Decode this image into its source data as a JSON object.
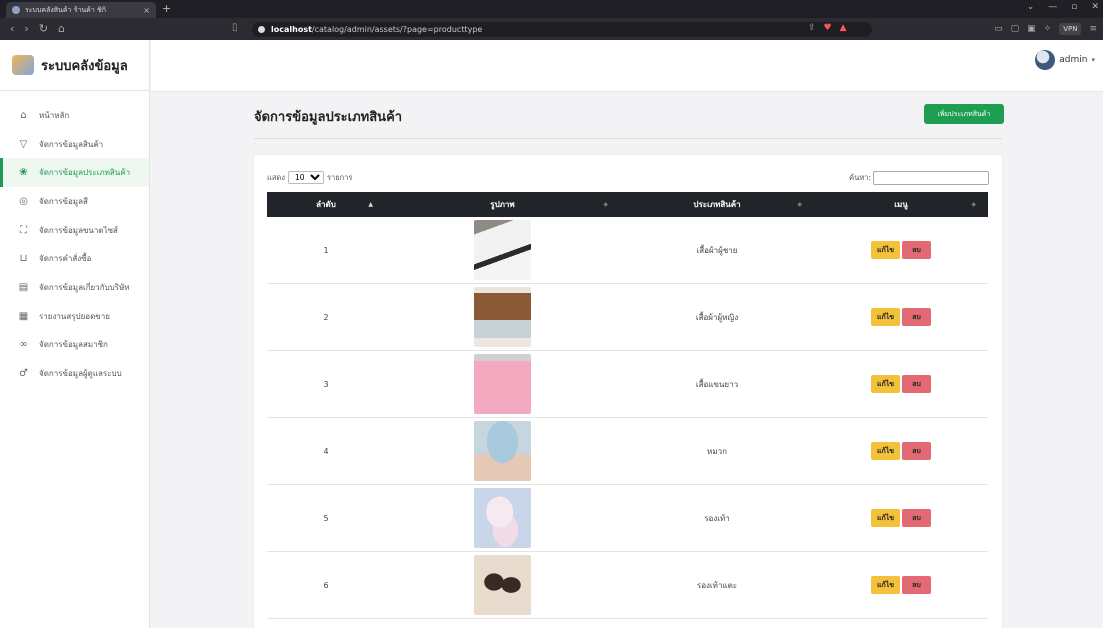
{
  "browser": {
    "tab_title": "ระบบคลังสินค้า ร้านค้า ชิกิ",
    "tab_close": "×",
    "new_tab": "+",
    "url_host": "localhost",
    "url_path": "/catalog/admin/assets/?page=producttype",
    "vpn_label": "VPN"
  },
  "brand": {
    "name": "ระบบคลังข้อมูล"
  },
  "sidebar": {
    "items": [
      {
        "label": "หน้าหลัก",
        "icon": "home-icon"
      },
      {
        "label": "จัดการข้อมูลสินค้า",
        "icon": "shirt-icon"
      },
      {
        "label": "จัดการข้อมูลประเภทสินค้า",
        "icon": "category-icon",
        "active": true
      },
      {
        "label": "จัดการข้อมูลสี",
        "icon": "palette-icon"
      },
      {
        "label": "จัดการข้อมูลขนาดไซส์",
        "icon": "resize-icon"
      },
      {
        "label": "จัดการคำสั่งซื้อ",
        "icon": "cart-icon"
      },
      {
        "label": "จัดการข้อมูลเกี่ยวกับบริษัท",
        "icon": "id-card-icon"
      },
      {
        "label": "รายงานสรุปยอดขาย",
        "icon": "report-icon"
      },
      {
        "label": "จัดการข้อมูลสมาชิก",
        "icon": "members-icon"
      },
      {
        "label": "จัดการข้อมูลผู้ดูแลระบบ",
        "icon": "admin-user-icon"
      }
    ]
  },
  "topbar": {
    "username": "admin"
  },
  "page": {
    "title": "จัดการข้อมูลประเภทสินค้า",
    "add_button": "เพิ่มประเภทสินค้า"
  },
  "table": {
    "length_prefix": "แสดง",
    "length_value": "10",
    "length_suffix": "รายการ",
    "search_label": "ค้นหา:",
    "columns": [
      "ลำดับ",
      "รูปภาพ",
      "ประเภทสินค้า",
      "เมนู"
    ],
    "edit_label": "แก้ไข",
    "delete_label": "ลบ",
    "rows": [
      {
        "no": "1",
        "type": "เสื้อผ้าผู้ชาย",
        "image": "men-clothing-photo"
      },
      {
        "no": "2",
        "type": "เสื้อผ้าผู้หญิง",
        "image": "women-clothing-photo"
      },
      {
        "no": "3",
        "type": "เสื้อแขนยาว",
        "image": "long-sleeve-photo"
      },
      {
        "no": "4",
        "type": "หมวก",
        "image": "hat-photo"
      },
      {
        "no": "5",
        "type": "รองเท้า",
        "image": "shoes-photo"
      },
      {
        "no": "6",
        "type": "รองเท้าแตะ",
        "image": "sandals-photo"
      }
    ]
  },
  "colors": {
    "accent_green": "#1e9e52",
    "table_header": "#212529",
    "edit_button": "#f3c23a",
    "delete_button": "#e36a74"
  }
}
